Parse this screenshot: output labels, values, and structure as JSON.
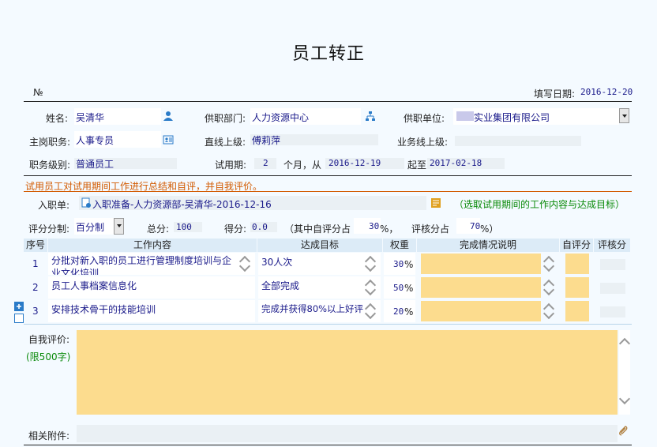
{
  "title": "员工转正",
  "no_label": "№",
  "fill_date_label": "填写日期:",
  "fill_date": "2016-12-20",
  "name_label": "姓名:",
  "name_value": "吴清华",
  "dept_label": "供职部门:",
  "dept_value": "人力资源中心",
  "unit_label": "供职单位:",
  "unit_value": "实业集团有限公司",
  "position_label": "主岗职务:",
  "position_value": "人事专员",
  "superior_label": "直线上级:",
  "superior_value": "傅莉萍",
  "biz_superior_label": "业务线上级:",
  "level_label": "职务级别:",
  "level_value": "普通员工",
  "probation_label": "试用期:",
  "probation_months": "2",
  "probation_from_label": "个月，从",
  "probation_from": "2016-12-19",
  "probation_to_label": "起至",
  "probation_to": "2017-02-18",
  "instruction": "试用员工对试用期间工作进行总结和自评，并自我评价。",
  "entry_label": "入职单:",
  "entry_value": "入职准备-人力资源部-吴清华-2016-12-16",
  "entry_hint": "（选取试用期间的工作内容与达成目标）",
  "score_system_label": "评分分制:",
  "score_system_value": "百分制",
  "total_label": "总分:",
  "total_value": "100",
  "score_label": "得分:",
  "score_value": "0.0",
  "self_ratio_label": "（其中自评分占",
  "self_ratio_value": "30",
  "self_ratio_unit": "%，",
  "review_ratio_label": "评核分占",
  "review_ratio_value": "70",
  "review_ratio_unit": "%）",
  "table": {
    "headers": [
      "序号",
      "工作内容",
      "达成目标",
      "权重",
      "完成情况说明",
      "自评分",
      "评核分"
    ],
    "rows": [
      {
        "no": "1",
        "content": "分批对新入职的员工进行管理制度培训与企业文化培训",
        "target": "30人次",
        "weight": "30",
        "unit": "%"
      },
      {
        "no": "2",
        "content": "员工人事档案信息化",
        "target": "全部完成",
        "weight": "50",
        "unit": "%"
      },
      {
        "no": "3",
        "content": "安排技术骨干的技能培训",
        "target": "完成并获得80%以上好评",
        "weight": "20",
        "unit": "%"
      }
    ]
  },
  "self_eval_label": "自我评价:",
  "self_eval_limit": "(限500字)",
  "attachment_label": "相关附件:",
  "icons": {
    "person": "person-icon",
    "org": "org-tree-icon",
    "card": "id-card-icon",
    "entry": "document-link-icon",
    "picker": "list-picker-icon",
    "add": "plus-icon",
    "remove": "minus-icon",
    "attach": "paperclip-icon"
  }
}
